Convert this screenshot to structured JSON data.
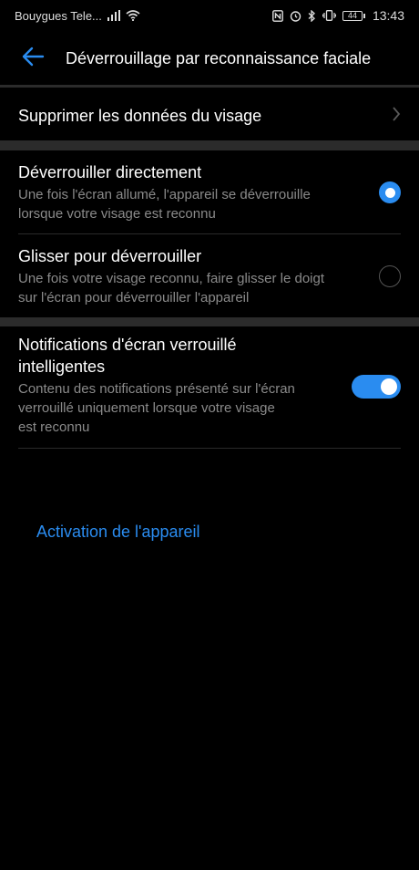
{
  "status_bar": {
    "carrier": "Bouygues Tele...",
    "time": "13:43",
    "battery": "44",
    "icons": [
      "signal-icon",
      "wifi-icon",
      "nfc-icon",
      "alarm-icon",
      "bluetooth-icon",
      "vibrate-icon",
      "battery-icon"
    ]
  },
  "header": {
    "title": "Déverrouillage par reconnaissance faciale",
    "back_icon": "back-arrow-icon"
  },
  "rows": {
    "delete_face": {
      "title": "Supprimer les données du visage"
    },
    "unlock_direct": {
      "title": "Déverrouiller directement",
      "subtitle_line1": "Une fois l'écran allumé, l'appareil se déverrouille",
      "subtitle_line2": "lorsque votre visage est reconnu",
      "selected": true
    },
    "swipe_unlock": {
      "title": "Glisser pour déverrouiller",
      "subtitle_line1": "Une fois votre visage reconnu, faire glisser le doigt",
      "subtitle_line2": "sur l'écran pour déverrouiller l'appareil",
      "selected": false
    },
    "smart_notifications": {
      "title_line1": "Notifications d'écran verrouillé",
      "title_line2": "intelligentes",
      "subtitle_line1": "Contenu des notifications présenté sur l'écran",
      "subtitle_line2": "verrouillé uniquement lorsque votre visage",
      "subtitle_line3": "est reconnu",
      "enabled": true
    }
  },
  "footer": {
    "link": "Activation de l'appareil"
  },
  "colors": {
    "accent": "#2a8cf0",
    "background": "#000000",
    "divider": "#2b2b2b",
    "secondary_text": "#8a8a8a"
  }
}
